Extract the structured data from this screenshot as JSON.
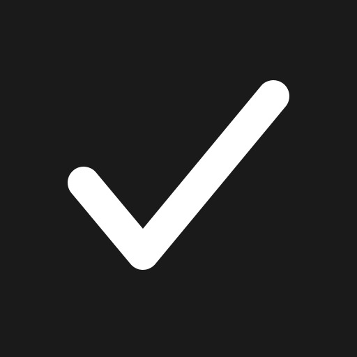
{
  "page": {
    "background_color": "#1a1a1a"
  },
  "icon": {
    "name": "checkmark-icon",
    "color": "#ffffff"
  }
}
